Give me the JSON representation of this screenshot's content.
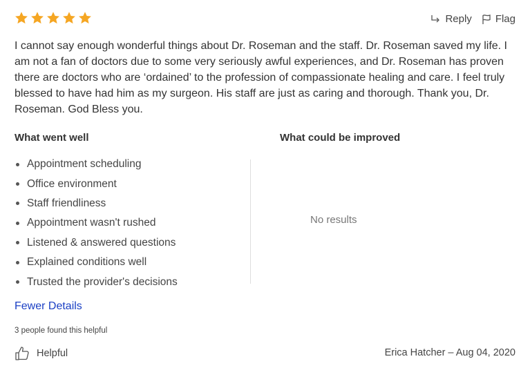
{
  "rating": {
    "value": 5,
    "max": 5,
    "star_color": "#f5a623"
  },
  "actions": {
    "reply_label": "Reply",
    "flag_label": "Flag",
    "reply_icon": "reply-arrow-icon",
    "flag_icon": "flag-icon"
  },
  "review": {
    "text": "I cannot say enough wonderful things about Dr. Roseman and the staff. Dr. Roseman saved my life. I am not a fan of doctors due to some very seriously awful experiences, and Dr. Roseman has proven there are doctors who are ‘ordained’ to the profession of compassionate healing and care. I feel truly blessed to have had him as my surgeon. His staff are just as caring and thorough. Thank you, Dr. Roseman. God Bless you."
  },
  "went_well": {
    "heading": "What went well",
    "items": [
      "Appointment scheduling",
      "Office environment",
      "Staff friendliness",
      "Appointment wasn't rushed",
      "Listened & answered questions",
      "Explained conditions well",
      "Trusted the provider's decisions"
    ]
  },
  "improve": {
    "heading": "What could be improved",
    "empty_text": "No results"
  },
  "toggle": {
    "label": "Fewer Details",
    "color": "#1a3fc4"
  },
  "helpful": {
    "count_text": "3 people found this helpful",
    "button_label": "Helpful",
    "icon": "thumbs-up-icon"
  },
  "author": {
    "line": "Erica Hatcher – Aug 04, 2020"
  }
}
